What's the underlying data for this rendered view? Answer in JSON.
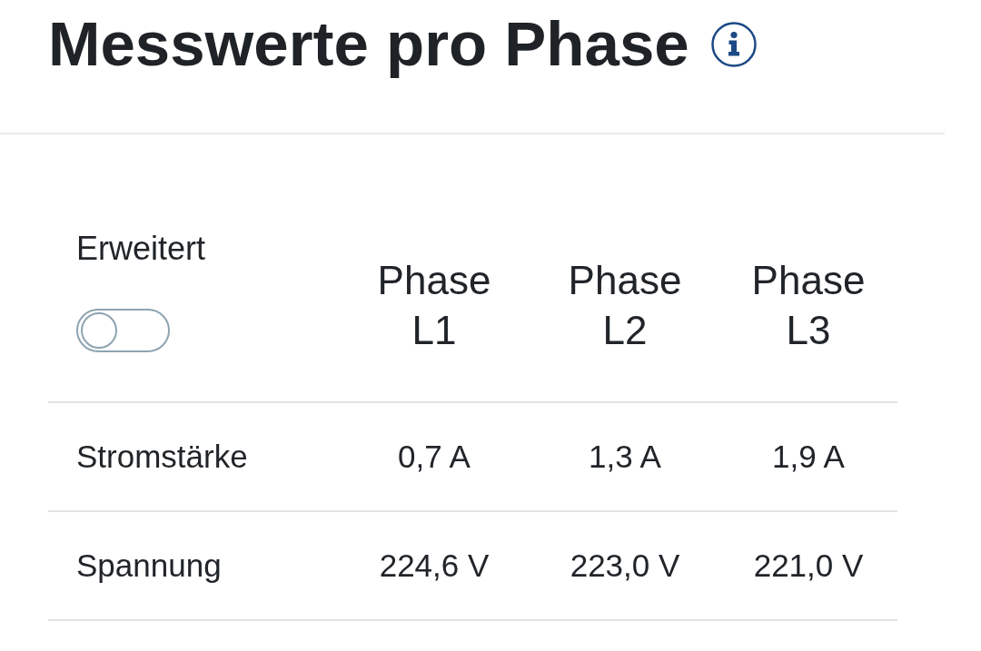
{
  "title": "Messwerte pro Phase",
  "table": {
    "toggle": {
      "label": "Erweitert",
      "on": false
    },
    "columns": [
      "Phase L1",
      "Phase L2",
      "Phase L3"
    ],
    "rows": [
      {
        "label": "Stromstärke",
        "cells": [
          "0,7 A",
          "1,3 A",
          "1,9 A"
        ]
      },
      {
        "label": "Spannung",
        "cells": [
          "224,6 V",
          "223,0 V",
          "221,0 V"
        ]
      }
    ]
  }
}
